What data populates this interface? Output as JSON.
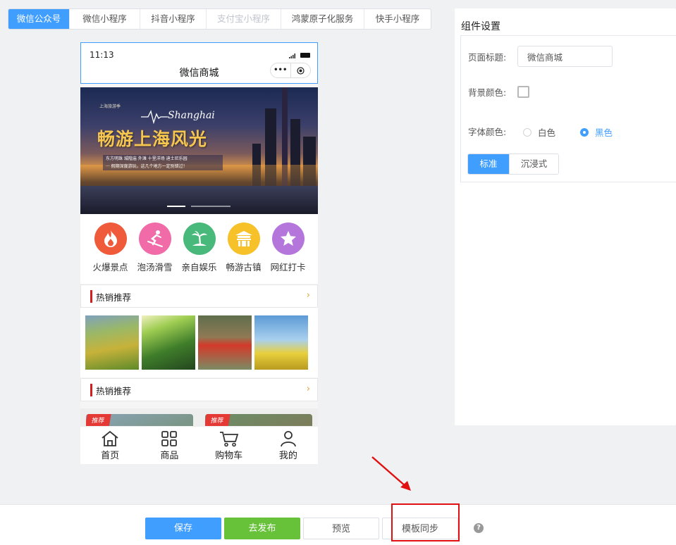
{
  "tabs": [
    {
      "label": "微信公众号",
      "state": "active"
    },
    {
      "label": "微信小程序",
      "state": "normal"
    },
    {
      "label": "抖音小程序",
      "state": "normal"
    },
    {
      "label": "支付宝小程序",
      "state": "disabled"
    },
    {
      "label": "鸿蒙原子化服务",
      "state": "normal"
    },
    {
      "label": "快手小程序",
      "state": "normal"
    }
  ],
  "phone": {
    "time": "11:13",
    "title": "微信商城",
    "capsule_more": "•••",
    "banner": {
      "small_text": "上海旅游季",
      "english": "Shanghai",
      "main_text": "畅游上海风光",
      "desc_line1": "东方明珠  城隍庙  外滩  十里洋场  迪士尼乐园",
      "desc_line2": "··· 假期深度游玩，这几个地方一定别错过！"
    },
    "nav": [
      {
        "label": "火爆景点",
        "icon": "flame-icon",
        "color": "#ef5a3a"
      },
      {
        "label": "泡汤滑雪",
        "icon": "skier-icon",
        "color": "#f06ba8"
      },
      {
        "label": "亲自娱乐",
        "icon": "palm-tree-icon",
        "color": "#48b97a"
      },
      {
        "label": "畅游古镇",
        "icon": "temple-icon",
        "color": "#f6c129"
      },
      {
        "label": "网红打卡",
        "icon": "star-icon",
        "color": "#b576dc"
      }
    ],
    "section1": {
      "title": "热销推荐",
      "arrow": "›"
    },
    "section2": {
      "title": "热销推荐",
      "arrow": "›"
    },
    "card_tag": "推荐",
    "bottom_nav": [
      {
        "label": "首页",
        "icon": "home-icon"
      },
      {
        "label": "商品",
        "icon": "grid-icon"
      },
      {
        "label": "购物车",
        "icon": "cart-icon"
      },
      {
        "label": "我的",
        "icon": "user-icon"
      }
    ]
  },
  "panel": {
    "title": "组件设置",
    "page_title_label": "页面标题:",
    "page_title_value": "微信商城",
    "bg_color_label": "背景颜色:",
    "font_color_label": "字体颜色:",
    "font_color_options": [
      {
        "label": "白色",
        "selected": false
      },
      {
        "label": "黑色",
        "selected": true
      }
    ],
    "style_options": [
      {
        "label": "标准",
        "selected": true
      },
      {
        "label": "沉浸式",
        "selected": false
      }
    ]
  },
  "footer": {
    "save": "保存",
    "publish": "去发布",
    "preview": "预览",
    "sync": "模板同步",
    "help": "?"
  },
  "colors": {
    "accent": "#409eff",
    "publish": "#67c23a",
    "highlight": "#e01010"
  }
}
